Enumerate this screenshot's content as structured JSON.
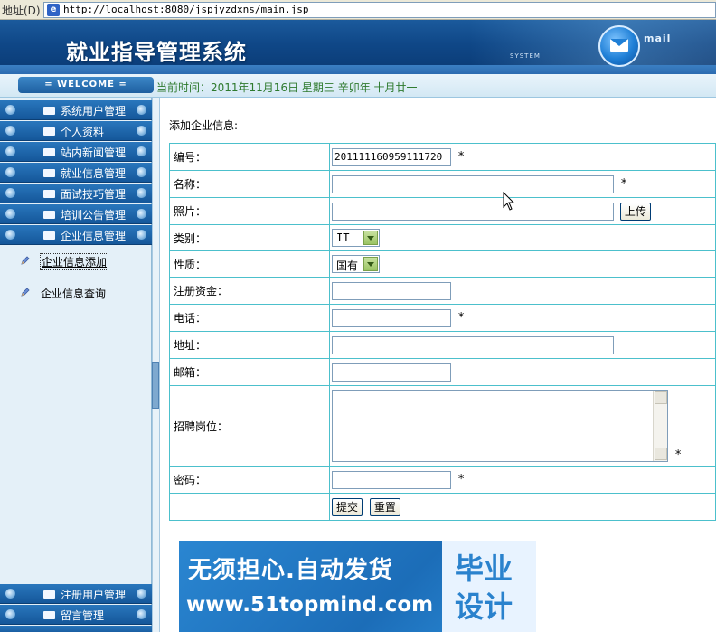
{
  "browser": {
    "address_label": "地址(D)",
    "url": "http://localhost:8080/jspjyzdxns/main.jsp"
  },
  "header": {
    "title": "就业指导管理系统",
    "system_text": "SYSTEM",
    "brand_text": "mail"
  },
  "welcome": {
    "label": "= WELCOME =",
    "current_time": "当前时间：2011年11月16日 星期三 辛卯年 十月廿一"
  },
  "sidebar": {
    "menu": [
      {
        "label": "系统用户管理"
      },
      {
        "label": "个人资料"
      },
      {
        "label": "站内新闻管理"
      },
      {
        "label": "就业信息管理"
      },
      {
        "label": "面试技巧管理"
      },
      {
        "label": "培训公告管理"
      },
      {
        "label": "企业信息管理"
      }
    ],
    "submenu": [
      {
        "label": "企业信息添加",
        "active": true
      },
      {
        "label": "企业信息查询",
        "active": false
      }
    ],
    "bottom_menu": [
      {
        "label": "注册用户管理"
      },
      {
        "label": "留言管理"
      }
    ]
  },
  "main": {
    "heading": "添加企业信息:",
    "form": {
      "id_label": "编号：",
      "id_value": "201111160959111720",
      "name_label": "名称：",
      "name_value": "",
      "photo_label": "照片：",
      "photo_value": "",
      "upload_button": "上传",
      "category_label": "类别：",
      "category_value": "IT",
      "nature_label": "性质：",
      "nature_value": "国有",
      "capital_label": "注册资金：",
      "capital_value": "",
      "phone_label": "电话：",
      "phone_value": "",
      "address_label": "地址：",
      "address_value": "",
      "email_label": "邮箱：",
      "email_value": "",
      "positions_label": "招聘岗位：",
      "positions_value": "",
      "password_label": "密码：",
      "password_value": "",
      "required_mark": "*",
      "submit_button": "提交",
      "reset_button": "重置"
    }
  },
  "ad": {
    "line1": "无须担心.自动发货",
    "line2": "www.51topmind.com",
    "box_line1": "毕业",
    "box_line2": "设计"
  }
}
